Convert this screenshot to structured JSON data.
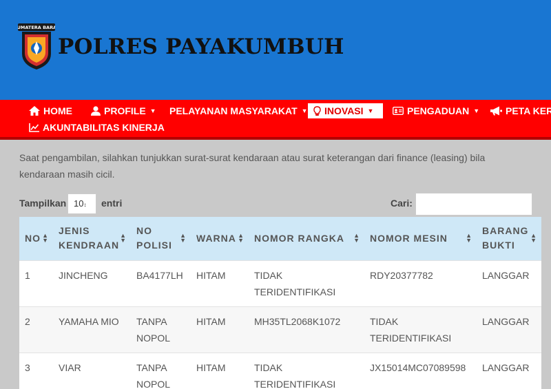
{
  "header": {
    "site_title": "POLRES PAYAKUMBUH",
    "logo_text": "SUMATERA BARAT",
    "bg_color": "#1976d2"
  },
  "nav": {
    "bg_color": "#ff0000",
    "items": [
      {
        "label": "HOME",
        "icon": "home-icon"
      },
      {
        "label": "PROFILE",
        "icon": "user-icon"
      },
      {
        "label": "PELAYANAN MASYARAKAT",
        "icon": ""
      },
      {
        "label": "INOVASI",
        "icon": "lightbulb-icon"
      },
      {
        "label": "PENGADUAN",
        "icon": "id-card-icon"
      },
      {
        "label": "PETA KERAWANAN",
        "icon": "megaphone-icon"
      },
      {
        "label": "AKUNTABILITAS KINERJA",
        "icon": "line-chart-icon"
      }
    ],
    "caret": "▼"
  },
  "notice": "Saat pengambilan, silahkan tunjukkan surat-surat kendaraan atau surat keterangan dari finance (leasing) bila kendaraan masih cicil.",
  "controls": {
    "length_label": "Tampilkan",
    "length_value": "10",
    "length_suffix": "entri",
    "search_label": "Cari:",
    "search_value": ""
  },
  "table": {
    "columns": [
      "NO",
      "JENIS KENDRAAN",
      "NO POLISI",
      "WARNA",
      "NOMOR RANGKA",
      "NOMOR MESIN",
      "BARANG BUKTI"
    ],
    "rows": [
      [
        "1",
        "JINCHENG",
        "BA4177LH",
        "HITAM",
        "TIDAK TERIDENTIFIKASI",
        "RDY20377782",
        "LANGGAR"
      ],
      [
        "2",
        "YAMAHA MIO",
        "TANPA NOPOL",
        "HITAM",
        "MH35TL2068K1072",
        "TIDAK TERIDENTIFIKASI",
        "LANGGAR"
      ],
      [
        "3",
        "VIAR",
        "TANPA NOPOL",
        "HITAM",
        "TIDAK TERIDENTIFIKASI",
        "JX15014MC07089598",
        "LANGGAR"
      ]
    ],
    "sort_up": "▲",
    "sort_down": "▼",
    "header_bg": "#cfe8f7"
  }
}
